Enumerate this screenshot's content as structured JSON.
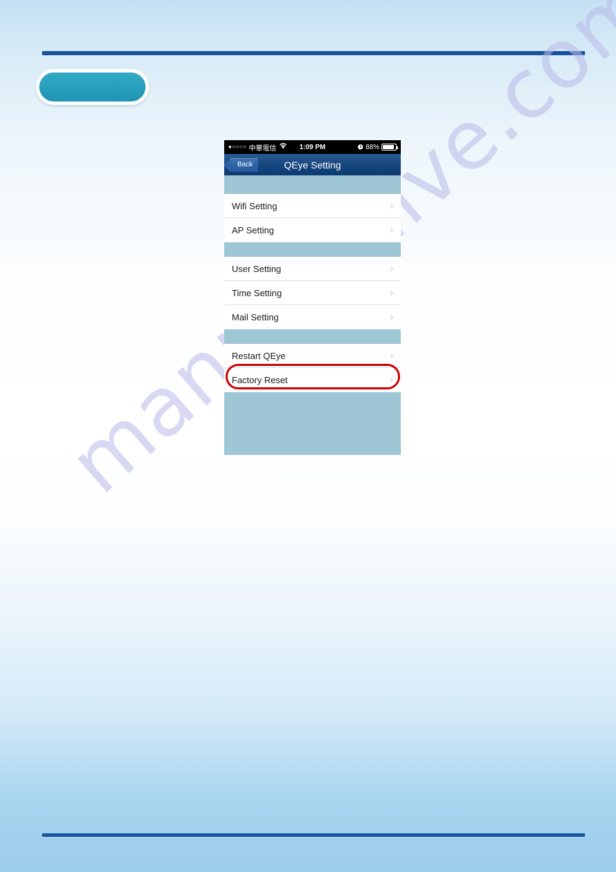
{
  "page": {
    "watermark_text": "manualshive.com",
    "accent_rule_color": "#17539f",
    "tab_pill_color": "#28a0bd"
  },
  "phone": {
    "status_bar": {
      "signal_dots": "●○○○○",
      "carrier": "中華電信",
      "wifi_icon": "wifi-icon",
      "time": "1:09 PM",
      "alarm_icon": "⏰",
      "battery_percent": "88%"
    },
    "nav_bar": {
      "back_label": "Back",
      "title": "QEye Setting"
    },
    "groups": [
      {
        "rows": [
          {
            "label": "Wifi Setting",
            "chevron": "›",
            "highlighted": false
          },
          {
            "label": "AP Setting",
            "chevron": "›",
            "highlighted": false
          }
        ]
      },
      {
        "rows": [
          {
            "label": "User Setting",
            "chevron": "›",
            "highlighted": false
          },
          {
            "label": "Time Setting",
            "chevron": "›",
            "highlighted": false
          },
          {
            "label": "Mail Setting",
            "chevron": "›",
            "highlighted": false
          }
        ]
      },
      {
        "rows": [
          {
            "label": "Restart QEye",
            "chevron": "›",
            "highlighted": false
          },
          {
            "label": "Factory Reset",
            "chevron": "›",
            "highlighted": true
          }
        ]
      }
    ],
    "annotation": {
      "target_label": "Factory Reset",
      "color": "#cc0000"
    }
  }
}
